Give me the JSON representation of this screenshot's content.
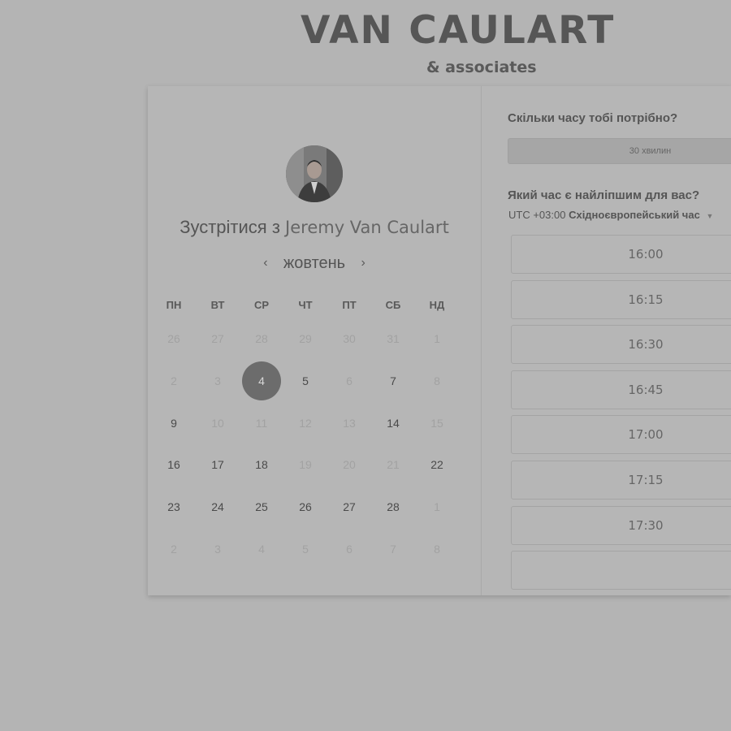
{
  "brand": {
    "title": "VAN CAULART",
    "subtitle": "& associates"
  },
  "booking": {
    "meet_prefix": "Зустрітися з",
    "host_name": "Jeremy Van Caulart",
    "month": "жовтень",
    "prev_icon": "chevron-left-icon",
    "next_icon": "chevron-right-icon"
  },
  "calendar": {
    "weekdays": [
      "ПН",
      "ВТ",
      "СР",
      "ЧТ",
      "ПТ",
      "СБ",
      "НД"
    ],
    "selected_day": "4",
    "weeks": [
      [
        {
          "d": "26",
          "s": "muted"
        },
        {
          "d": "27",
          "s": "muted"
        },
        {
          "d": "28",
          "s": "muted"
        },
        {
          "d": "29",
          "s": "muted"
        },
        {
          "d": "30",
          "s": "muted"
        },
        {
          "d": "31",
          "s": "muted"
        },
        {
          "d": "1",
          "s": "muted"
        }
      ],
      [
        {
          "d": "2",
          "s": "muted"
        },
        {
          "d": "3",
          "s": "muted"
        },
        {
          "d": "4",
          "s": "selected"
        },
        {
          "d": "5",
          "s": "active"
        },
        {
          "d": "6",
          "s": "muted"
        },
        {
          "d": "7",
          "s": "active"
        },
        {
          "d": "8",
          "s": "muted"
        }
      ],
      [
        {
          "d": "9",
          "s": "active"
        },
        {
          "d": "10",
          "s": "muted"
        },
        {
          "d": "11",
          "s": "muted"
        },
        {
          "d": "12",
          "s": "muted"
        },
        {
          "d": "13",
          "s": "muted"
        },
        {
          "d": "14",
          "s": "active"
        },
        {
          "d": "15",
          "s": "muted"
        }
      ],
      [
        {
          "d": "16",
          "s": "active"
        },
        {
          "d": "17",
          "s": "active"
        },
        {
          "d": "18",
          "s": "active"
        },
        {
          "d": "19",
          "s": "muted"
        },
        {
          "d": "20",
          "s": "muted"
        },
        {
          "d": "21",
          "s": "muted"
        },
        {
          "d": "22",
          "s": "active"
        }
      ],
      [
        {
          "d": "23",
          "s": "active"
        },
        {
          "d": "24",
          "s": "active"
        },
        {
          "d": "25",
          "s": "active"
        },
        {
          "d": "26",
          "s": "active"
        },
        {
          "d": "27",
          "s": "active"
        },
        {
          "d": "28",
          "s": "active"
        },
        {
          "d": "1",
          "s": "muted"
        }
      ],
      [
        {
          "d": "2",
          "s": "muted"
        },
        {
          "d": "3",
          "s": "muted"
        },
        {
          "d": "4",
          "s": "muted"
        },
        {
          "d": "5",
          "s": "muted"
        },
        {
          "d": "6",
          "s": "muted"
        },
        {
          "d": "7",
          "s": "muted"
        },
        {
          "d": "8",
          "s": "muted"
        }
      ]
    ]
  },
  "scheduler": {
    "duration_question": "Скільки часу тобі потрібно?",
    "duration_value": "30 хвилин",
    "time_question": "Який час є найліпшим для вас?",
    "timezone_offset": "UTC +03:00",
    "timezone_name": "Східноєвропейський час",
    "timezone_icon": "caret-down-icon",
    "slots": [
      "16:00",
      "16:15",
      "16:30",
      "16:45",
      "17:00",
      "17:15",
      "17:30"
    ]
  },
  "colors": {
    "background": "#b4b4b4",
    "selected_day": "#6c6c6c",
    "card": "#b6b6b6"
  }
}
